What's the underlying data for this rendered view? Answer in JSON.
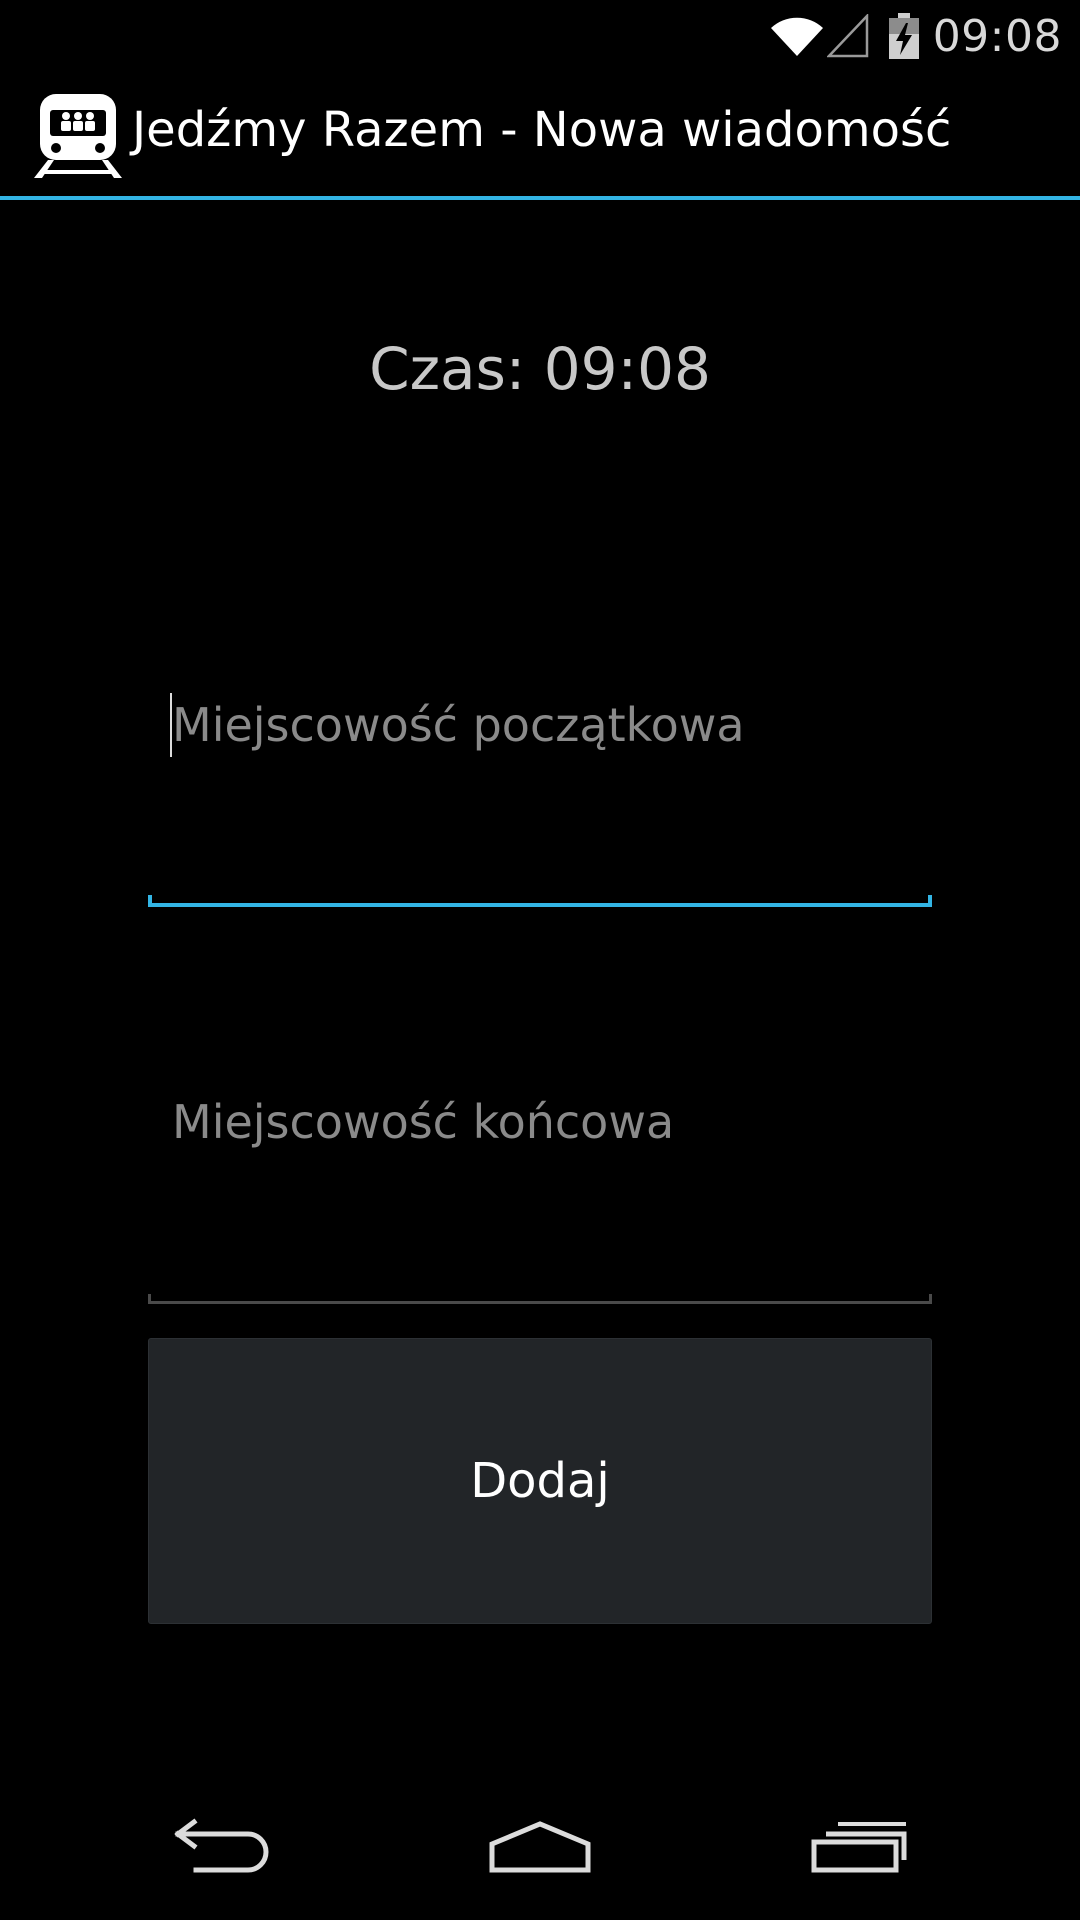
{
  "status_bar": {
    "time": "09:08",
    "icons": [
      "wifi-icon",
      "signal-icon",
      "battery-charging-icon"
    ]
  },
  "action_bar": {
    "title": "Jedźmy Razem - Nowa wiadomość",
    "icon": "train-app-icon",
    "accent_color": "#33b5e5"
  },
  "content": {
    "time_label": "Czas: 09:08",
    "start_field": {
      "placeholder": "Miejscowość początkowa",
      "value": ""
    },
    "end_field": {
      "placeholder": "Miejscowość końcowa",
      "value": ""
    },
    "add_button_label": "Dodaj"
  },
  "nav_bar": {
    "buttons": [
      "back-icon",
      "home-icon",
      "recents-icon"
    ]
  }
}
